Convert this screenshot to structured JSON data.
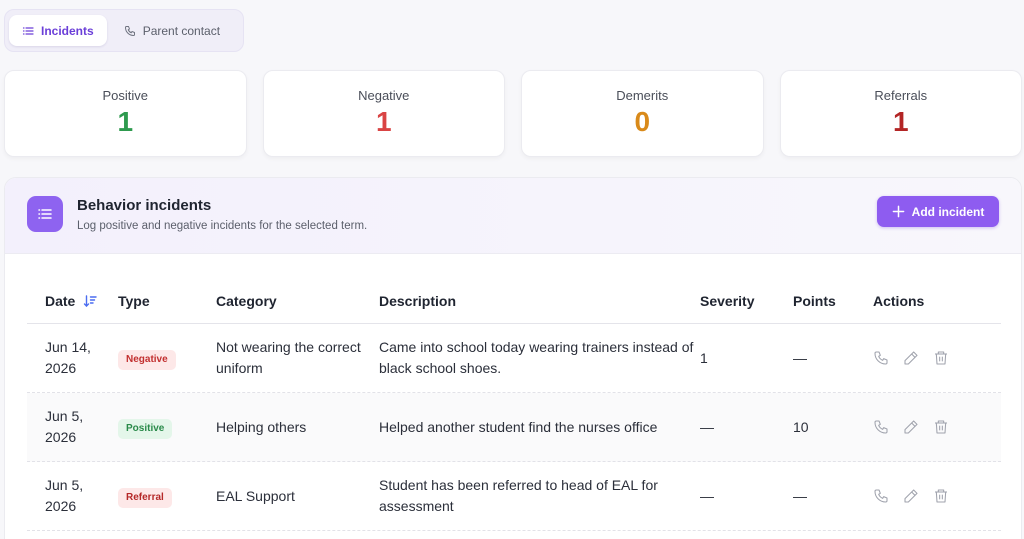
{
  "tabs": [
    {
      "label": "Incidents",
      "icon": "list-icon",
      "active": true
    },
    {
      "label": "Parent contact",
      "icon": "phone-icon",
      "active": false
    }
  ],
  "stats": [
    {
      "label": "Positive",
      "value": "1",
      "color": "#2e9a4e"
    },
    {
      "label": "Negative",
      "value": "1",
      "color": "#d94444"
    },
    {
      "label": "Demerits",
      "value": "0",
      "color": "#d98a1a"
    },
    {
      "label": "Referrals",
      "value": "1",
      "color": "#b32525"
    }
  ],
  "panel": {
    "title": "Behavior incidents",
    "subtitle": "Log positive and negative incidents for the selected term.",
    "add_label": "Add incident",
    "accent": "#8e5cf0"
  },
  "table": {
    "headers": {
      "date": "Date",
      "type": "Type",
      "category": "Category",
      "description": "Description",
      "severity": "Severity",
      "points": "Points",
      "actions": "Actions"
    },
    "rows": [
      {
        "date": "Jun 14, 2026",
        "type": "Negative",
        "category": "Not wearing the correct uniform",
        "description": "Came into school today wearing trainers instead of black school shoes.",
        "severity": "1",
        "points": "—"
      },
      {
        "date": "Jun 5, 2026",
        "type": "Positive",
        "category": "Helping others",
        "description": "Helped another student find the nurses office",
        "severity": "—",
        "points": "10"
      },
      {
        "date": "Jun 5, 2026",
        "type": "Referral",
        "category": "EAL Support",
        "description": "Student has been referred to head of EAL for assessment",
        "severity": "—",
        "points": "—"
      }
    ]
  }
}
